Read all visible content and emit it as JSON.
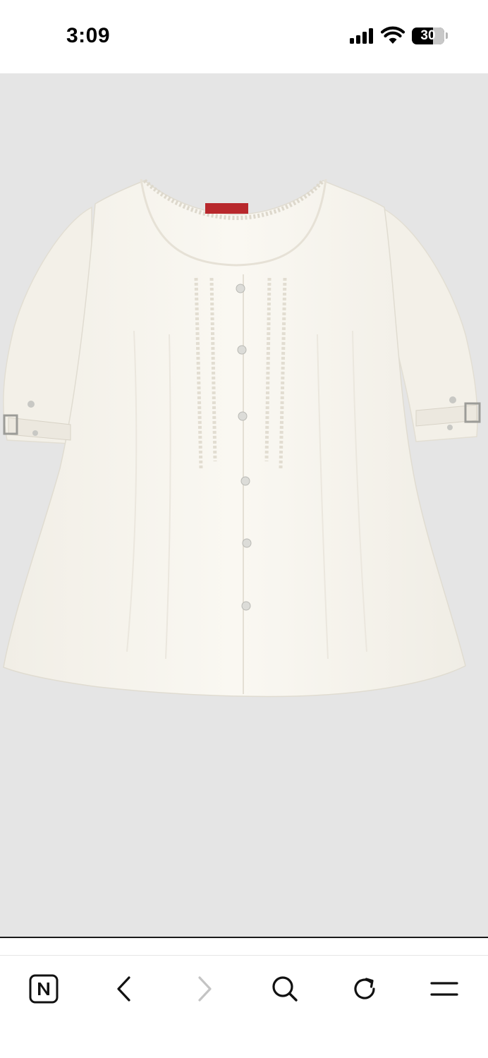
{
  "status_bar": {
    "time": "3:09",
    "battery_level": "30",
    "icons": [
      "signal-icon",
      "wifi-icon",
      "battery-icon"
    ]
  },
  "content": {
    "image_subject": "white-blouse",
    "background_color": "#e5e5e5"
  },
  "toolbar": {
    "buttons": [
      {
        "name": "naver-home-button",
        "icon": "n-logo-icon"
      },
      {
        "name": "back-button",
        "icon": "chevron-left-icon"
      },
      {
        "name": "forward-button",
        "icon": "chevron-right-icon",
        "disabled": true
      },
      {
        "name": "search-button",
        "icon": "search-icon"
      },
      {
        "name": "refresh-button",
        "icon": "refresh-icon"
      },
      {
        "name": "menu-button",
        "icon": "menu-icon"
      }
    ]
  }
}
